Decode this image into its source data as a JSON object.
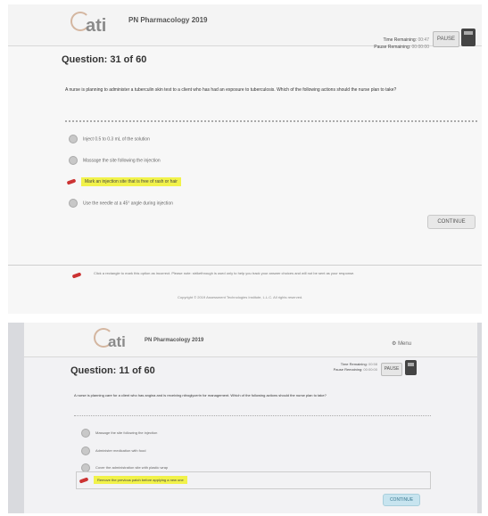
{
  "screens": [
    {
      "logo": "ati",
      "course": "PN Pharmacology 2019",
      "question_title": "Question: 31 of 60",
      "time_remaining_label": "Time Remaining:",
      "time_remaining_value": "00:47",
      "pause_remaining_label": "Pause Remaining:",
      "pause_remaining_value": "00:00:00",
      "pause_label": "PAUSE",
      "stem": "A nurse is planning to administer a tuberculin skin test to a client who has had an exposure to tuberculosis. Which of the following actions should the nurse plan to take?",
      "options": [
        "Inject 0.5 to 0.3 mL of the solution",
        "Massage the site following the injection",
        "Mark an injection site that is free of rash or hair",
        "Use the needle at a 45° angle during injection"
      ],
      "selected_option": 2,
      "continue_label": "CONTINUE",
      "footer_notice": "Click a rectangle to mark this option as incorrect. Please note: strikethrough is used only to help you track your answer choices and will not be sent as your response.",
      "copyright": "Copyright © 2019 Assessment Technologies Institute, L.L.C. All rights reserved."
    },
    {
      "logo": "ati",
      "course": "PN Pharmacology 2019",
      "user_menu": "Menu",
      "question_title": "Question: 11 of 60",
      "time_remaining_label": "Time Remaining:",
      "time_remaining_value": "00:58",
      "pause_remaining_label": "Pause Remaining:",
      "pause_remaining_value": "00:00:00",
      "pause_label": "PAUSE",
      "stem": "A nurse is planning care for a client who has angina and is receiving nitroglycerin for management. Which of the following actions should the nurse plan to take?",
      "options": [
        "Massage the site following the injection",
        "Administer medication with food",
        "Cover the administration site with plastic wrap",
        "Remove the previous patch before applying a new one"
      ],
      "selected_option": 3,
      "continue_label": "CONTINUE"
    }
  ],
  "colors": {
    "highlight": "#f1f24a",
    "continue_blue": "#c7e4ef",
    "incorrect_mark": "#cc3333"
  },
  "icons": [
    "ati-logo-icon",
    "calculator-icon",
    "strikethrough-mark-icon",
    "gear-icon"
  ]
}
